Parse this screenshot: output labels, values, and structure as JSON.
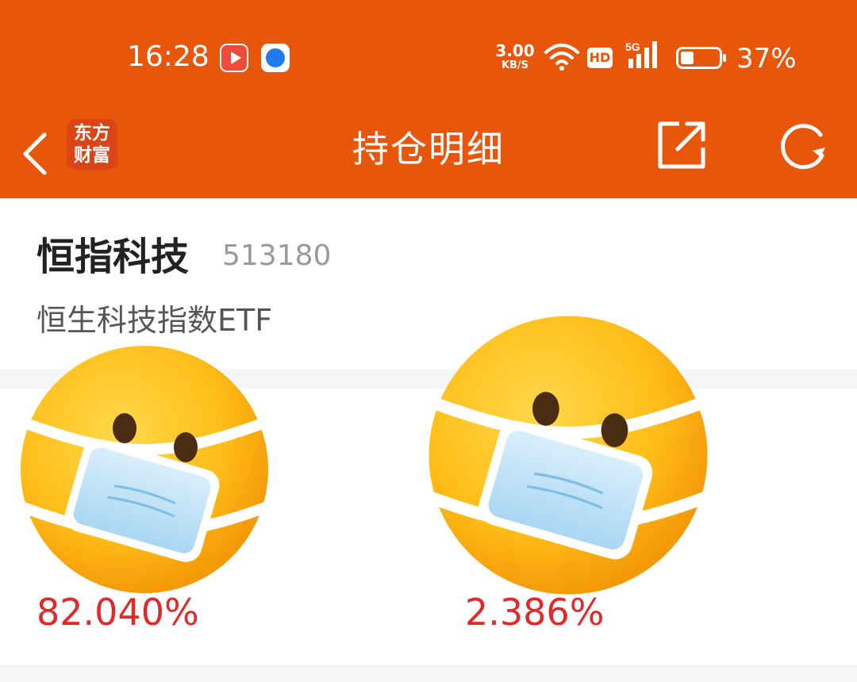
{
  "status_bar": {
    "time": "16:28",
    "net_speed_value": "3.00",
    "net_speed_unit": "KB/S",
    "hd_label": "HD",
    "network_type": "5G",
    "battery_percent": "37%",
    "battery_level": 0.37,
    "icons": [
      "video-app-icon",
      "browser-app-icon",
      "wifi-icon",
      "signal-icon",
      "battery-icon"
    ]
  },
  "nav": {
    "brand_line1": "东方",
    "brand_line2": "财富",
    "title": "持仓明细",
    "icons": [
      "back-arrow-icon",
      "share-icon",
      "refresh-icon"
    ]
  },
  "fund": {
    "name": "恒指科技",
    "code": "513180",
    "full_name": "恒生科技指数ETF"
  },
  "holdings": [
    {
      "percent": "82.040%",
      "overlay_icon": "mask-face-emoji"
    },
    {
      "percent": "2.386%",
      "overlay_icon": "mask-face-emoji"
    }
  ],
  "colors": {
    "brand_orange": "#e8560a",
    "value_red": "#de2a2a"
  }
}
